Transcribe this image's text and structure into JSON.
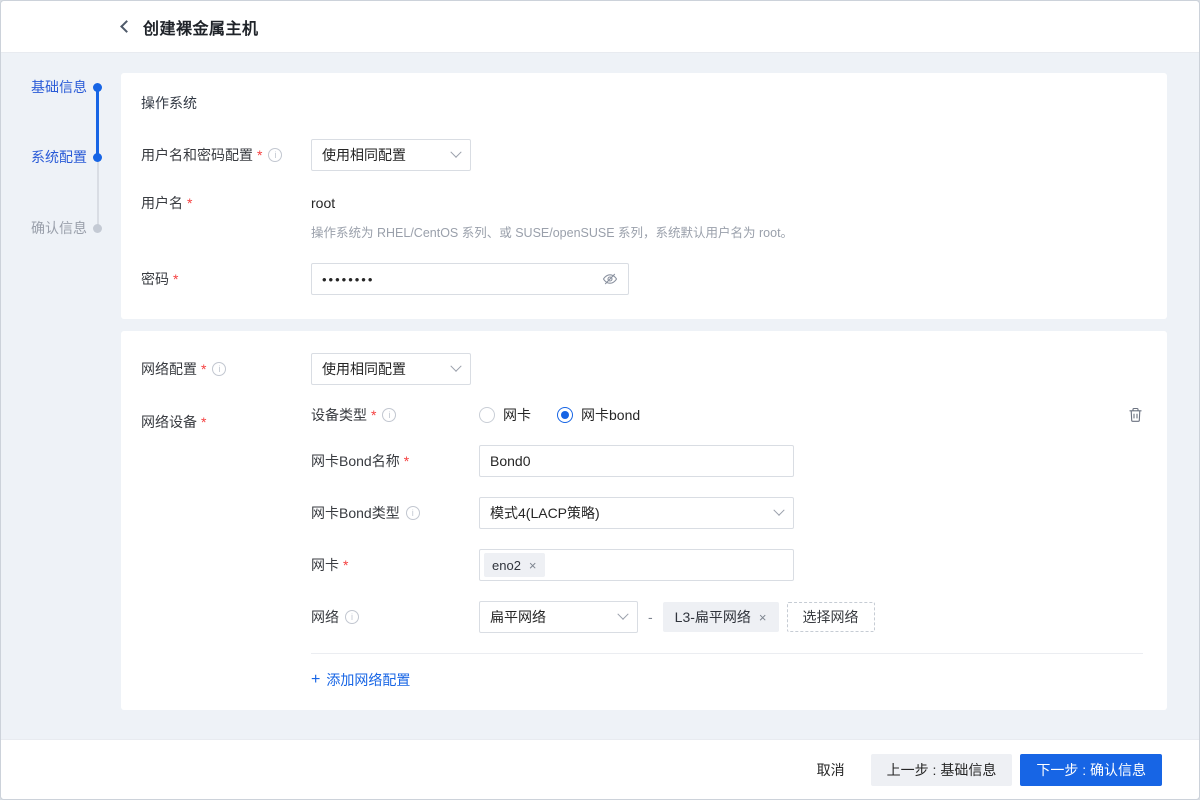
{
  "colors": {
    "accent": "#1765E5",
    "danger": "#F53F3F",
    "tag_bg": "#EEF0F4"
  },
  "header": {
    "title": "创建裸金属主机"
  },
  "steps": {
    "items": [
      {
        "label": "基础信息",
        "state": "done"
      },
      {
        "label": "系统配置",
        "state": "active"
      },
      {
        "label": "确认信息",
        "state": "pending"
      }
    ]
  },
  "os_card": {
    "title": "操作系统",
    "credential_mode": {
      "label": "用户名和密码配置",
      "required": "*",
      "value": "使用相同配置"
    },
    "username": {
      "label": "用户名",
      "required": "*",
      "value": "root",
      "help": "操作系统为 RHEL/CentOS 系列、或 SUSE/openSUSE 系列，系统默认用户名为 root。"
    },
    "password": {
      "label": "密码",
      "required": "*",
      "masked_value": "••••••••"
    }
  },
  "net_card": {
    "network_config": {
      "label": "网络配置",
      "required": "*",
      "value": "使用相同配置"
    },
    "device_group": {
      "label": "网络设备",
      "required": "*"
    },
    "device_type": {
      "label": "设备类型",
      "required": "*",
      "options": [
        {
          "label": "网卡",
          "selected": false
        },
        {
          "label": "网卡bond",
          "selected": true
        }
      ]
    },
    "bond_name": {
      "label": "网卡Bond名称",
      "required": "*",
      "value": "Bond0"
    },
    "bond_type": {
      "label": "网卡Bond类型",
      "value": "模式4(LACP策略)"
    },
    "nic": {
      "label": "网卡",
      "required": "*",
      "tag": "eno2",
      "remove_icon": "×"
    },
    "network": {
      "label": "网络",
      "type_value": "扁平网络",
      "separator": "-",
      "tag": "L3-扁平网络",
      "remove_icon": "×",
      "choose_button": "选择网络"
    },
    "add_config": {
      "icon": "+",
      "label": "添加网络配置"
    }
  },
  "footer": {
    "cancel": "取消",
    "prev": "上一步 : 基础信息",
    "next": "下一步 : 确认信息"
  }
}
